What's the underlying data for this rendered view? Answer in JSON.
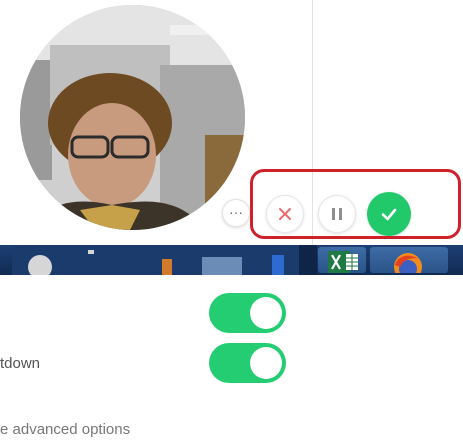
{
  "recorder": {
    "more_glyph": "···",
    "cancel_icon": "x-icon",
    "pause_icon": "pause-icon",
    "done_icon": "check-icon",
    "accent_color": "#22c96a",
    "highlight_color": "#d0202b"
  },
  "taskbar": {
    "apps": [
      "excel-icon",
      "firefox-icon"
    ]
  },
  "settings": {
    "toggle_1": {
      "on": true
    },
    "toggle_2": {
      "label": "tdown",
      "on": true
    },
    "advanced_link": "e advanced options"
  }
}
